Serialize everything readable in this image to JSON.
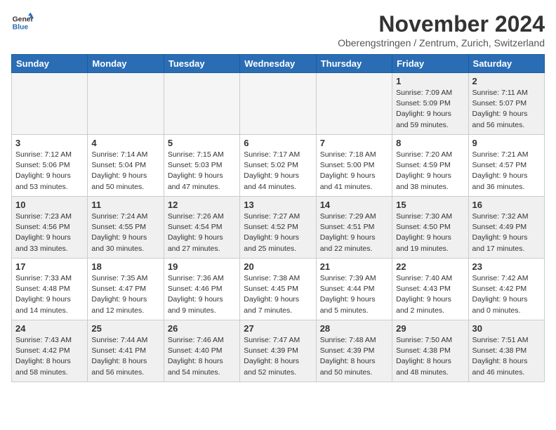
{
  "header": {
    "logo_line1": "General",
    "logo_line2": "Blue",
    "month_title": "November 2024",
    "subtitle": "Oberengstringen / Zentrum, Zurich, Switzerland"
  },
  "days_of_week": [
    "Sunday",
    "Monday",
    "Tuesday",
    "Wednesday",
    "Thursday",
    "Friday",
    "Saturday"
  ],
  "weeks": [
    [
      {
        "day": "",
        "info": "",
        "empty": true
      },
      {
        "day": "",
        "info": "",
        "empty": true
      },
      {
        "day": "",
        "info": "",
        "empty": true
      },
      {
        "day": "",
        "info": "",
        "empty": true
      },
      {
        "day": "",
        "info": "",
        "empty": true
      },
      {
        "day": "1",
        "info": "Sunrise: 7:09 AM\nSunset: 5:09 PM\nDaylight: 9 hours\nand 59 minutes.",
        "empty": false
      },
      {
        "day": "2",
        "info": "Sunrise: 7:11 AM\nSunset: 5:07 PM\nDaylight: 9 hours\nand 56 minutes.",
        "empty": false
      }
    ],
    [
      {
        "day": "3",
        "info": "Sunrise: 7:12 AM\nSunset: 5:06 PM\nDaylight: 9 hours\nand 53 minutes.",
        "empty": false
      },
      {
        "day": "4",
        "info": "Sunrise: 7:14 AM\nSunset: 5:04 PM\nDaylight: 9 hours\nand 50 minutes.",
        "empty": false
      },
      {
        "day": "5",
        "info": "Sunrise: 7:15 AM\nSunset: 5:03 PM\nDaylight: 9 hours\nand 47 minutes.",
        "empty": false
      },
      {
        "day": "6",
        "info": "Sunrise: 7:17 AM\nSunset: 5:02 PM\nDaylight: 9 hours\nand 44 minutes.",
        "empty": false
      },
      {
        "day": "7",
        "info": "Sunrise: 7:18 AM\nSunset: 5:00 PM\nDaylight: 9 hours\nand 41 minutes.",
        "empty": false
      },
      {
        "day": "8",
        "info": "Sunrise: 7:20 AM\nSunset: 4:59 PM\nDaylight: 9 hours\nand 38 minutes.",
        "empty": false
      },
      {
        "day": "9",
        "info": "Sunrise: 7:21 AM\nSunset: 4:57 PM\nDaylight: 9 hours\nand 36 minutes.",
        "empty": false
      }
    ],
    [
      {
        "day": "10",
        "info": "Sunrise: 7:23 AM\nSunset: 4:56 PM\nDaylight: 9 hours\nand 33 minutes.",
        "empty": false
      },
      {
        "day": "11",
        "info": "Sunrise: 7:24 AM\nSunset: 4:55 PM\nDaylight: 9 hours\nand 30 minutes.",
        "empty": false
      },
      {
        "day": "12",
        "info": "Sunrise: 7:26 AM\nSunset: 4:54 PM\nDaylight: 9 hours\nand 27 minutes.",
        "empty": false
      },
      {
        "day": "13",
        "info": "Sunrise: 7:27 AM\nSunset: 4:52 PM\nDaylight: 9 hours\nand 25 minutes.",
        "empty": false
      },
      {
        "day": "14",
        "info": "Sunrise: 7:29 AM\nSunset: 4:51 PM\nDaylight: 9 hours\nand 22 minutes.",
        "empty": false
      },
      {
        "day": "15",
        "info": "Sunrise: 7:30 AM\nSunset: 4:50 PM\nDaylight: 9 hours\nand 19 minutes.",
        "empty": false
      },
      {
        "day": "16",
        "info": "Sunrise: 7:32 AM\nSunset: 4:49 PM\nDaylight: 9 hours\nand 17 minutes.",
        "empty": false
      }
    ],
    [
      {
        "day": "17",
        "info": "Sunrise: 7:33 AM\nSunset: 4:48 PM\nDaylight: 9 hours\nand 14 minutes.",
        "empty": false
      },
      {
        "day": "18",
        "info": "Sunrise: 7:35 AM\nSunset: 4:47 PM\nDaylight: 9 hours\nand 12 minutes.",
        "empty": false
      },
      {
        "day": "19",
        "info": "Sunrise: 7:36 AM\nSunset: 4:46 PM\nDaylight: 9 hours\nand 9 minutes.",
        "empty": false
      },
      {
        "day": "20",
        "info": "Sunrise: 7:38 AM\nSunset: 4:45 PM\nDaylight: 9 hours\nand 7 minutes.",
        "empty": false
      },
      {
        "day": "21",
        "info": "Sunrise: 7:39 AM\nSunset: 4:44 PM\nDaylight: 9 hours\nand 5 minutes.",
        "empty": false
      },
      {
        "day": "22",
        "info": "Sunrise: 7:40 AM\nSunset: 4:43 PM\nDaylight: 9 hours\nand 2 minutes.",
        "empty": false
      },
      {
        "day": "23",
        "info": "Sunrise: 7:42 AM\nSunset: 4:42 PM\nDaylight: 9 hours\nand 0 minutes.",
        "empty": false
      }
    ],
    [
      {
        "day": "24",
        "info": "Sunrise: 7:43 AM\nSunset: 4:42 PM\nDaylight: 8 hours\nand 58 minutes.",
        "empty": false
      },
      {
        "day": "25",
        "info": "Sunrise: 7:44 AM\nSunset: 4:41 PM\nDaylight: 8 hours\nand 56 minutes.",
        "empty": false
      },
      {
        "day": "26",
        "info": "Sunrise: 7:46 AM\nSunset: 4:40 PM\nDaylight: 8 hours\nand 54 minutes.",
        "empty": false
      },
      {
        "day": "27",
        "info": "Sunrise: 7:47 AM\nSunset: 4:39 PM\nDaylight: 8 hours\nand 52 minutes.",
        "empty": false
      },
      {
        "day": "28",
        "info": "Sunrise: 7:48 AM\nSunset: 4:39 PM\nDaylight: 8 hours\nand 50 minutes.",
        "empty": false
      },
      {
        "day": "29",
        "info": "Sunrise: 7:50 AM\nSunset: 4:38 PM\nDaylight: 8 hours\nand 48 minutes.",
        "empty": false
      },
      {
        "day": "30",
        "info": "Sunrise: 7:51 AM\nSunset: 4:38 PM\nDaylight: 8 hours\nand 46 minutes.",
        "empty": false
      }
    ]
  ]
}
